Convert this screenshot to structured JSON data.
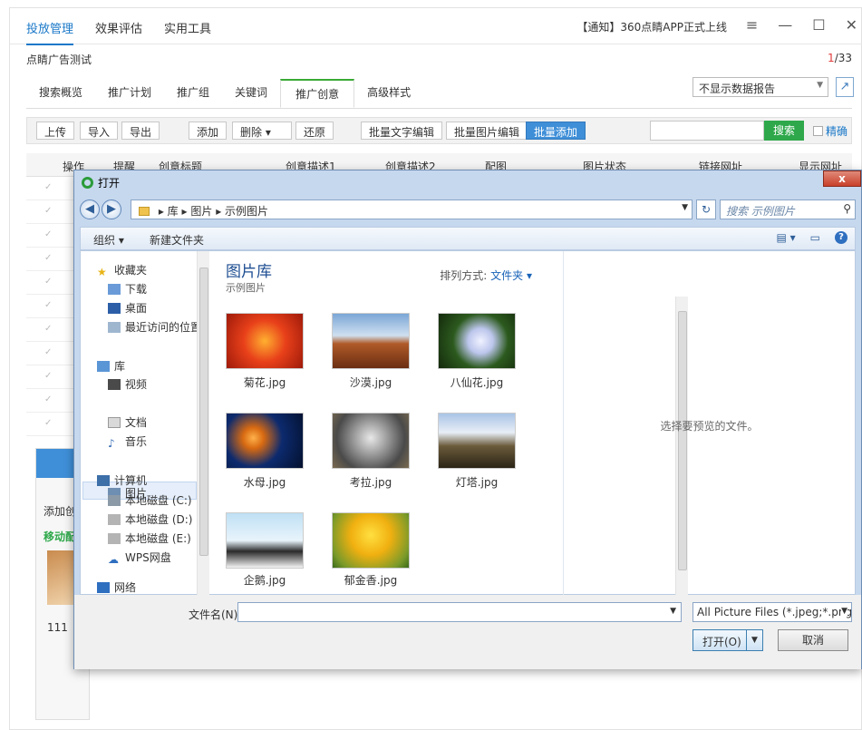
{
  "app": {
    "nav": [
      "投放管理",
      "效果评估",
      "实用工具"
    ],
    "notice": "【通知】360点睛APP正式上线",
    "window_controls": [
      "≡",
      "—",
      "☐",
      "✕"
    ],
    "account": "点睛广告测试",
    "page_current": "1",
    "page_total": "/33",
    "tabs": [
      "搜索概览",
      "推广计划",
      "推广组",
      "关键词",
      "推广创意",
      "高级样式"
    ],
    "report_select": "不显示数据报告",
    "toolbar": {
      "upload": "上传",
      "import": "导入",
      "export": "导出",
      "add": "添加",
      "delete": "删除",
      "restore": "还原",
      "batch_text": "批量文字编辑",
      "batch_img": "批量图片编辑",
      "batch_add": "批量添加",
      "search_btn": "搜索",
      "exact": "精确"
    },
    "columns": [
      "操作",
      "提醒",
      "创意标题",
      "创意描述1",
      "创意描述2",
      "配图",
      "图片状态",
      "链接网址",
      "显示网址"
    ],
    "bottom_panel": {
      "label1": "添加创",
      "label2": "移动配",
      "id": "111"
    }
  },
  "dialog": {
    "title": "打开",
    "close": "x",
    "breadcrumb": [
      "库",
      "图片",
      "示例图片"
    ],
    "search_placeholder": "搜索 示例图片",
    "organize": "组织 ▾",
    "new_folder": "新建文件夹",
    "nav_items": {
      "favorites": "收藏夹",
      "downloads": "下载",
      "desktop": "桌面",
      "recent": "最近访问的位置",
      "libraries": "库",
      "videos": "视频",
      "pictures": "图片",
      "documents": "文档",
      "music": "音乐",
      "computer": "计算机",
      "disk_c": "本地磁盘 (C:)",
      "disk_d": "本地磁盘 (D:)",
      "disk_e": "本地磁盘 (E:)",
      "wps": "WPS网盘",
      "network": "网络"
    },
    "library_title": "图片库",
    "library_sub": "示例图片",
    "sort_label": "排列方式:",
    "sort_value": "文件夹 ▾",
    "files": [
      "菊花.jpg",
      "沙漠.jpg",
      "八仙花.jpg",
      "水母.jpg",
      "考拉.jpg",
      "灯塔.jpg",
      "企鹅.jpg",
      "郁金香.jpg"
    ],
    "preview_text": "选择要预览的文件。",
    "filename_label": "文件名(N):",
    "filetype": "All Picture Files (*.jpeg;*.png;",
    "open_btn": "打开(O)",
    "cancel_btn": "取消"
  }
}
